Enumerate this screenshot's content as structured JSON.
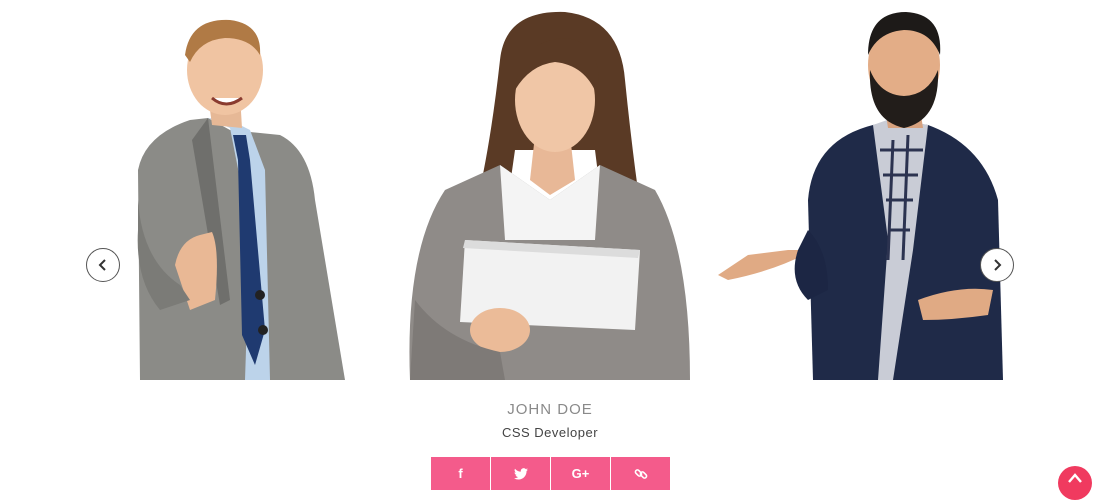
{
  "carousel": {
    "slides": [
      {
        "position": "left",
        "photo": "man-gray-suit-handshake"
      },
      {
        "position": "center",
        "photo": "woman-holding-folder"
      },
      {
        "position": "right",
        "photo": "bearded-man-navy-blazer"
      }
    ],
    "prev_icon": "chevron-left-icon",
    "next_icon": "chevron-right-icon"
  },
  "member": {
    "name": "JOHN DOE",
    "role": "CSS Developer"
  },
  "social": {
    "facebook": "f",
    "twitter": "twitter-bird-icon",
    "google_plus": "G+",
    "link": "link-icon"
  },
  "colors": {
    "accent": "#f45b8b",
    "back_to_top": "#f03a5f",
    "name_text": "#8a8a8a",
    "role_text": "#444444"
  },
  "back_to_top_icon": "chevron-up-icon"
}
